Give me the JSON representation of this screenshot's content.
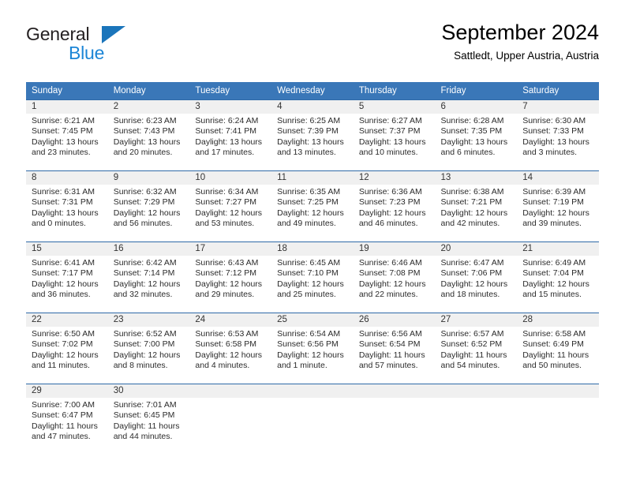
{
  "logo": {
    "word_one": "General",
    "word_two": "Blue",
    "triangle": "triangle-icon",
    "accent_dark": "#231f20",
    "accent_blue": "#1b85d6",
    "triangle_blue": "#1b75bb"
  },
  "header": {
    "title": "September 2024",
    "subtitle": "Sattledt, Upper Austria, Austria"
  },
  "colors": {
    "header_row_bg": "#3a77b8",
    "header_row_text": "#ffffff",
    "daynum_band_bg": "#f0f0f0",
    "row_separator": "#2f6aa8",
    "body_text": "#2b2b2b"
  },
  "weekdays": [
    "Sunday",
    "Monday",
    "Tuesday",
    "Wednesday",
    "Thursday",
    "Friday",
    "Saturday"
  ],
  "weeks": [
    [
      {
        "day": "1",
        "sunrise": "Sunrise: 6:21 AM",
        "sunset": "Sunset: 7:45 PM",
        "daylight": "Daylight: 13 hours and 23 minutes."
      },
      {
        "day": "2",
        "sunrise": "Sunrise: 6:23 AM",
        "sunset": "Sunset: 7:43 PM",
        "daylight": "Daylight: 13 hours and 20 minutes."
      },
      {
        "day": "3",
        "sunrise": "Sunrise: 6:24 AM",
        "sunset": "Sunset: 7:41 PM",
        "daylight": "Daylight: 13 hours and 17 minutes."
      },
      {
        "day": "4",
        "sunrise": "Sunrise: 6:25 AM",
        "sunset": "Sunset: 7:39 PM",
        "daylight": "Daylight: 13 hours and 13 minutes."
      },
      {
        "day": "5",
        "sunrise": "Sunrise: 6:27 AM",
        "sunset": "Sunset: 7:37 PM",
        "daylight": "Daylight: 13 hours and 10 minutes."
      },
      {
        "day": "6",
        "sunrise": "Sunrise: 6:28 AM",
        "sunset": "Sunset: 7:35 PM",
        "daylight": "Daylight: 13 hours and 6 minutes."
      },
      {
        "day": "7",
        "sunrise": "Sunrise: 6:30 AM",
        "sunset": "Sunset: 7:33 PM",
        "daylight": "Daylight: 13 hours and 3 minutes."
      }
    ],
    [
      {
        "day": "8",
        "sunrise": "Sunrise: 6:31 AM",
        "sunset": "Sunset: 7:31 PM",
        "daylight": "Daylight: 13 hours and 0 minutes."
      },
      {
        "day": "9",
        "sunrise": "Sunrise: 6:32 AM",
        "sunset": "Sunset: 7:29 PM",
        "daylight": "Daylight: 12 hours and 56 minutes."
      },
      {
        "day": "10",
        "sunrise": "Sunrise: 6:34 AM",
        "sunset": "Sunset: 7:27 PM",
        "daylight": "Daylight: 12 hours and 53 minutes."
      },
      {
        "day": "11",
        "sunrise": "Sunrise: 6:35 AM",
        "sunset": "Sunset: 7:25 PM",
        "daylight": "Daylight: 12 hours and 49 minutes."
      },
      {
        "day": "12",
        "sunrise": "Sunrise: 6:36 AM",
        "sunset": "Sunset: 7:23 PM",
        "daylight": "Daylight: 12 hours and 46 minutes."
      },
      {
        "day": "13",
        "sunrise": "Sunrise: 6:38 AM",
        "sunset": "Sunset: 7:21 PM",
        "daylight": "Daylight: 12 hours and 42 minutes."
      },
      {
        "day": "14",
        "sunrise": "Sunrise: 6:39 AM",
        "sunset": "Sunset: 7:19 PM",
        "daylight": "Daylight: 12 hours and 39 minutes."
      }
    ],
    [
      {
        "day": "15",
        "sunrise": "Sunrise: 6:41 AM",
        "sunset": "Sunset: 7:17 PM",
        "daylight": "Daylight: 12 hours and 36 minutes."
      },
      {
        "day": "16",
        "sunrise": "Sunrise: 6:42 AM",
        "sunset": "Sunset: 7:14 PM",
        "daylight": "Daylight: 12 hours and 32 minutes."
      },
      {
        "day": "17",
        "sunrise": "Sunrise: 6:43 AM",
        "sunset": "Sunset: 7:12 PM",
        "daylight": "Daylight: 12 hours and 29 minutes."
      },
      {
        "day": "18",
        "sunrise": "Sunrise: 6:45 AM",
        "sunset": "Sunset: 7:10 PM",
        "daylight": "Daylight: 12 hours and 25 minutes."
      },
      {
        "day": "19",
        "sunrise": "Sunrise: 6:46 AM",
        "sunset": "Sunset: 7:08 PM",
        "daylight": "Daylight: 12 hours and 22 minutes."
      },
      {
        "day": "20",
        "sunrise": "Sunrise: 6:47 AM",
        "sunset": "Sunset: 7:06 PM",
        "daylight": "Daylight: 12 hours and 18 minutes."
      },
      {
        "day": "21",
        "sunrise": "Sunrise: 6:49 AM",
        "sunset": "Sunset: 7:04 PM",
        "daylight": "Daylight: 12 hours and 15 minutes."
      }
    ],
    [
      {
        "day": "22",
        "sunrise": "Sunrise: 6:50 AM",
        "sunset": "Sunset: 7:02 PM",
        "daylight": "Daylight: 12 hours and 11 minutes."
      },
      {
        "day": "23",
        "sunrise": "Sunrise: 6:52 AM",
        "sunset": "Sunset: 7:00 PM",
        "daylight": "Daylight: 12 hours and 8 minutes."
      },
      {
        "day": "24",
        "sunrise": "Sunrise: 6:53 AM",
        "sunset": "Sunset: 6:58 PM",
        "daylight": "Daylight: 12 hours and 4 minutes."
      },
      {
        "day": "25",
        "sunrise": "Sunrise: 6:54 AM",
        "sunset": "Sunset: 6:56 PM",
        "daylight": "Daylight: 12 hours and 1 minute."
      },
      {
        "day": "26",
        "sunrise": "Sunrise: 6:56 AM",
        "sunset": "Sunset: 6:54 PM",
        "daylight": "Daylight: 11 hours and 57 minutes."
      },
      {
        "day": "27",
        "sunrise": "Sunrise: 6:57 AM",
        "sunset": "Sunset: 6:52 PM",
        "daylight": "Daylight: 11 hours and 54 minutes."
      },
      {
        "day": "28",
        "sunrise": "Sunrise: 6:58 AM",
        "sunset": "Sunset: 6:49 PM",
        "daylight": "Daylight: 11 hours and 50 minutes."
      }
    ],
    [
      {
        "day": "29",
        "sunrise": "Sunrise: 7:00 AM",
        "sunset": "Sunset: 6:47 PM",
        "daylight": "Daylight: 11 hours and 47 minutes."
      },
      {
        "day": "30",
        "sunrise": "Sunrise: 7:01 AM",
        "sunset": "Sunset: 6:45 PM",
        "daylight": "Daylight: 11 hours and 44 minutes."
      },
      {
        "day": "",
        "sunrise": "",
        "sunset": "",
        "daylight": ""
      },
      {
        "day": "",
        "sunrise": "",
        "sunset": "",
        "daylight": ""
      },
      {
        "day": "",
        "sunrise": "",
        "sunset": "",
        "daylight": ""
      },
      {
        "day": "",
        "sunrise": "",
        "sunset": "",
        "daylight": ""
      },
      {
        "day": "",
        "sunrise": "",
        "sunset": "",
        "daylight": ""
      }
    ]
  ]
}
